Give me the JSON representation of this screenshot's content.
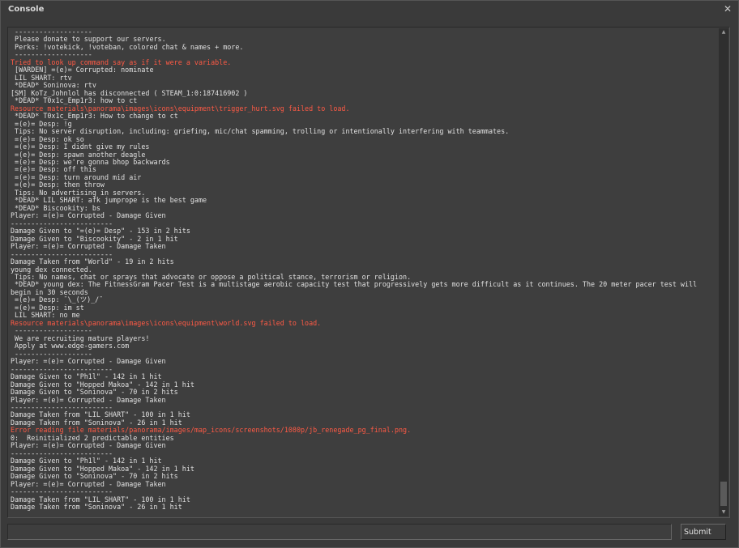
{
  "window": {
    "title": "Console",
    "close_glyph": "✕"
  },
  "colors": {
    "background": "#3a3a3a",
    "text": "#e0e0e0",
    "error_text": "#ff5a45"
  },
  "log": {
    "lines": [
      {
        "text": " -------------------",
        "error": false
      },
      {
        "text": " Please donate to support our servers.",
        "error": false
      },
      {
        "text": " Perks: !votekick, !voteban, colored chat & names + more.",
        "error": false
      },
      {
        "text": " -------------------",
        "error": false
      },
      {
        "text": "Tried to look up command say as if it were a variable.",
        "error": true
      },
      {
        "text": " [WARDEN] =(e)= Corrupted: nominate",
        "error": false
      },
      {
        "text": " LIL SHART: rtv",
        "error": false
      },
      {
        "text": " *DEAD* Soninova: rtv",
        "error": false
      },
      {
        "text": "[SM] KoTz_Johnlol has disconnected ( STEAM_1:0:187416902 )",
        "error": false
      },
      {
        "text": " *DEAD* T0x1c_Emp1r3: how to ct",
        "error": false
      },
      {
        "text": "Resource materials\\panorama\\images\\icons\\equipment\\trigger_hurt.svg failed to load.",
        "error": true
      },
      {
        "text": " *DEAD* T0x1c_Emp1r3: How to change to ct",
        "error": false
      },
      {
        "text": " =(e)= Desp: !g",
        "error": false
      },
      {
        "text": " Tips: No server disruption, including: griefing, mic/chat spamming, trolling or intentionally interfering with teammates.",
        "error": false
      },
      {
        "text": " =(e)= Desp: ok so",
        "error": false
      },
      {
        "text": " =(e)= Desp: I didnt give my rules",
        "error": false
      },
      {
        "text": " =(e)= Desp: spawn another deagle",
        "error": false
      },
      {
        "text": " =(e)= Desp: we're gonna bhop backwards",
        "error": false
      },
      {
        "text": " =(e)= Desp: off this",
        "error": false
      },
      {
        "text": " =(e)= Desp: turn around mid air",
        "error": false
      },
      {
        "text": " =(e)= Desp: then throw",
        "error": false
      },
      {
        "text": " Tips: No advertising in servers.",
        "error": false
      },
      {
        "text": " *DEAD* LIL SHART: afk jumprope is the best game",
        "error": false
      },
      {
        "text": " *DEAD* Biscookity: bs",
        "error": false
      },
      {
        "text": "Player: =(e)= Corrupted - Damage Given",
        "error": false
      },
      {
        "text": "-------------------------",
        "error": false
      },
      {
        "text": "Damage Given to \"=(e)= Desp\" - 153 in 2 hits",
        "error": false
      },
      {
        "text": "Damage Given to \"Biscookity\" - 2 in 1 hit",
        "error": false
      },
      {
        "text": "Player: =(e)= Corrupted - Damage Taken",
        "error": false
      },
      {
        "text": "-------------------------",
        "error": false
      },
      {
        "text": "Damage Taken from \"World\" - 19 in 2 hits",
        "error": false
      },
      {
        "text": "young dex connected.",
        "error": false
      },
      {
        "text": " Tips: No names, chat or sprays that advocate or oppose a political stance, terrorism or religion.",
        "error": false
      },
      {
        "text": " *DEAD* young dex: The FitnessGram Pacer Test is a multistage aerobic capacity test that progressively gets more difficult as it continues. The 20 meter pacer test will begin in 30 seconds",
        "error": false
      },
      {
        "text": " =(e)= Desp: ¯\\_(ツ)_/¯",
        "error": false
      },
      {
        "text": " =(e)= Desp: im st",
        "error": false
      },
      {
        "text": " LIL SHART: no me",
        "error": false
      },
      {
        "text": "Resource materials\\panorama\\images\\icons\\equipment\\world.svg failed to load.",
        "error": true
      },
      {
        "text": " -------------------",
        "error": false
      },
      {
        "text": " We are recruiting mature players!",
        "error": false
      },
      {
        "text": " Apply at www.edge-gamers.com",
        "error": false
      },
      {
        "text": " -------------------",
        "error": false
      },
      {
        "text": "Player: =(e)= Corrupted - Damage Given",
        "error": false
      },
      {
        "text": "-------------------------",
        "error": false
      },
      {
        "text": "Damage Given to \"Ph1l\" - 142 in 1 hit",
        "error": false
      },
      {
        "text": "Damage Given to \"Hopped Makoa\" - 142 in 1 hit",
        "error": false
      },
      {
        "text": "Damage Given to \"Soninova\" - 70 in 2 hits",
        "error": false
      },
      {
        "text": "Player: =(e)= Corrupted - Damage Taken",
        "error": false
      },
      {
        "text": "-------------------------",
        "error": false
      },
      {
        "text": "Damage Taken from \"LIL SHART\" - 100 in 1 hit",
        "error": false
      },
      {
        "text": "Damage Taken from \"Soninova\" - 26 in 1 hit",
        "error": false
      },
      {
        "text": "Error reading file materials/panorama/images/map_icons/screenshots/1080p/jb_renegade_pg_final.png.",
        "error": true
      },
      {
        "text": "0:  Reinitialized 2 predictable entities",
        "error": false
      },
      {
        "text": "Player: =(e)= Corrupted - Damage Given",
        "error": false
      },
      {
        "text": "-------------------------",
        "error": false
      },
      {
        "text": "Damage Given to \"Ph1l\" - 142 in 1 hit",
        "error": false
      },
      {
        "text": "Damage Given to \"Hopped Makoa\" - 142 in 1 hit",
        "error": false
      },
      {
        "text": "Damage Given to \"Soninova\" - 70 in 2 hits",
        "error": false
      },
      {
        "text": "Player: =(e)= Corrupted - Damage Taken",
        "error": false
      },
      {
        "text": "-------------------------",
        "error": false
      },
      {
        "text": "Damage Taken from \"LIL SHART\" - 100 in 1 hit",
        "error": false
      },
      {
        "text": "Damage Taken from \"Soninova\" - 26 in 1 hit",
        "error": false
      }
    ]
  },
  "scrollbar": {
    "up_glyph": "▲",
    "down_glyph": "▼"
  },
  "command": {
    "value": "",
    "submit_label": "Submit"
  }
}
